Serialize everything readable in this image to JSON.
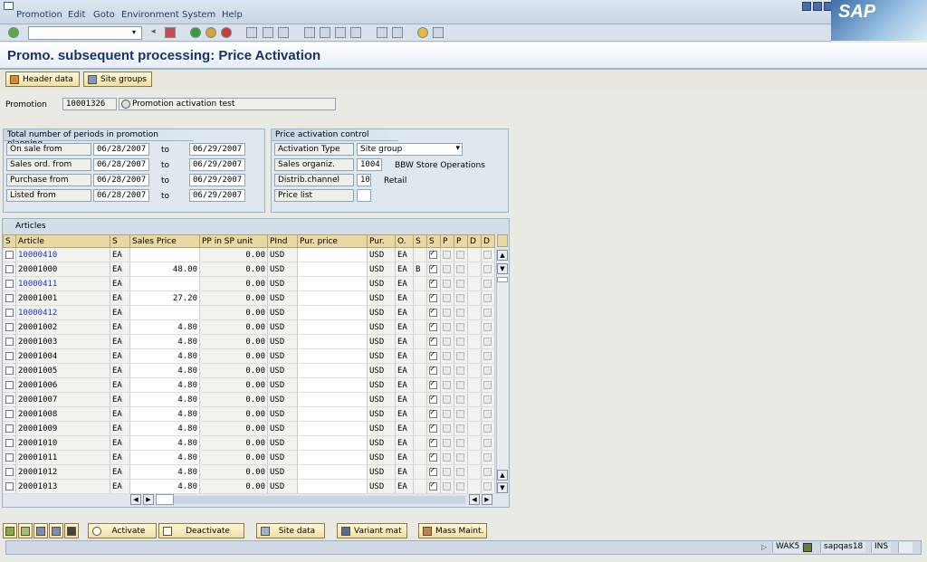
{
  "menu": {
    "items": [
      "Promotion",
      "Edit",
      "Goto",
      "Environment",
      "System",
      "Help"
    ]
  },
  "logo": "SAP",
  "toolbar": {
    "command_value": ""
  },
  "page_title": "Promo. subsequent processing: Price Activation",
  "app_buttons": {
    "header_data": "Header data",
    "site_groups": "Site groups"
  },
  "promotion": {
    "label": "Promotion",
    "number": "10001326",
    "description": "Promotion activation test"
  },
  "periods": {
    "title": "Total number of periods in promotion planning",
    "to_label": "to",
    "rows": [
      {
        "label": "On sale from",
        "from": "06/28/2007",
        "to": "06/29/2007"
      },
      {
        "label": "Sales ord. from",
        "from": "06/28/2007",
        "to": "06/29/2007"
      },
      {
        "label": "Purchase from",
        "from": "06/28/2007",
        "to": "06/29/2007"
      },
      {
        "label": "Listed from",
        "from": "06/28/2007",
        "to": "06/29/2007"
      }
    ]
  },
  "price_control": {
    "title": "Price activation control",
    "activation_type_label": "Activation Type",
    "activation_type_value": "Site group",
    "sales_org_label": "Sales organiz.",
    "sales_org_value": "1004",
    "sales_org_text": "BBW Store Operations",
    "distrib_label": "Distrib.channel",
    "distrib_value": "10",
    "distrib_text": "Retail",
    "price_list_label": "Price list",
    "price_list_value": ""
  },
  "articles": {
    "title": "Articles",
    "columns": [
      "S",
      "Article",
      "S",
      "Sales Price",
      "PP in SP unit",
      "PInd",
      "Pur. price",
      "Pur.",
      "O.",
      "S",
      "S",
      "P",
      "P",
      "D",
      "D"
    ],
    "rows": [
      {
        "article": "10000410",
        "link": true,
        "unit": "EA",
        "sales_price": "",
        "pp": "0.00",
        "pind": "USD",
        "pur_price": "",
        "pur": "USD",
        "o": "EA",
        "s": ""
      },
      {
        "article": "20001000",
        "link": false,
        "unit": "EA",
        "sales_price": "48.00",
        "pp": "0.00",
        "pind": "USD",
        "pur_price": "",
        "pur": "USD",
        "o": "EA",
        "s": "B"
      },
      {
        "article": "10000411",
        "link": true,
        "unit": "EA",
        "sales_price": "",
        "pp": "0.00",
        "pind": "USD",
        "pur_price": "",
        "pur": "USD",
        "o": "EA",
        "s": ""
      },
      {
        "article": "20001001",
        "link": false,
        "unit": "EA",
        "sales_price": "27.20",
        "pp": "0.00",
        "pind": "USD",
        "pur_price": "",
        "pur": "USD",
        "o": "EA",
        "s": ""
      },
      {
        "article": "10000412",
        "link": true,
        "unit": "EA",
        "sales_price": "",
        "pp": "0.00",
        "pind": "USD",
        "pur_price": "",
        "pur": "USD",
        "o": "EA",
        "s": ""
      },
      {
        "article": "20001002",
        "link": false,
        "unit": "EA",
        "sales_price": "4.80",
        "pp": "0.00",
        "pind": "USD",
        "pur_price": "",
        "pur": "USD",
        "o": "EA",
        "s": ""
      },
      {
        "article": "20001003",
        "link": false,
        "unit": "EA",
        "sales_price": "4.80",
        "pp": "0.00",
        "pind": "USD",
        "pur_price": "",
        "pur": "USD",
        "o": "EA",
        "s": ""
      },
      {
        "article": "20001004",
        "link": false,
        "unit": "EA",
        "sales_price": "4.80",
        "pp": "0.00",
        "pind": "USD",
        "pur_price": "",
        "pur": "USD",
        "o": "EA",
        "s": ""
      },
      {
        "article": "20001005",
        "link": false,
        "unit": "EA",
        "sales_price": "4.80",
        "pp": "0.00",
        "pind": "USD",
        "pur_price": "",
        "pur": "USD",
        "o": "EA",
        "s": ""
      },
      {
        "article": "20001006",
        "link": false,
        "unit": "EA",
        "sales_price": "4.80",
        "pp": "0.00",
        "pind": "USD",
        "pur_price": "",
        "pur": "USD",
        "o": "EA",
        "s": ""
      },
      {
        "article": "20001007",
        "link": false,
        "unit": "EA",
        "sales_price": "4.80",
        "pp": "0.00",
        "pind": "USD",
        "pur_price": "",
        "pur": "USD",
        "o": "EA",
        "s": ""
      },
      {
        "article": "20001008",
        "link": false,
        "unit": "EA",
        "sales_price": "4.80",
        "pp": "0.00",
        "pind": "USD",
        "pur_price": "",
        "pur": "USD",
        "o": "EA",
        "s": ""
      },
      {
        "article": "20001009",
        "link": false,
        "unit": "EA",
        "sales_price": "4.80",
        "pp": "0.00",
        "pind": "USD",
        "pur_price": "",
        "pur": "USD",
        "o": "EA",
        "s": ""
      },
      {
        "article": "20001010",
        "link": false,
        "unit": "EA",
        "sales_price": "4.80",
        "pp": "0.00",
        "pind": "USD",
        "pur_price": "",
        "pur": "USD",
        "o": "EA",
        "s": ""
      },
      {
        "article": "20001011",
        "link": false,
        "unit": "EA",
        "sales_price": "4.80",
        "pp": "0.00",
        "pind": "USD",
        "pur_price": "",
        "pur": "USD",
        "o": "EA",
        "s": ""
      },
      {
        "article": "20001012",
        "link": false,
        "unit": "EA",
        "sales_price": "4.80",
        "pp": "0.00",
        "pind": "USD",
        "pur_price": "",
        "pur": "USD",
        "o": "EA",
        "s": ""
      },
      {
        "article": "20001013",
        "link": false,
        "unit": "EA",
        "sales_price": "4.80",
        "pp": "0.00",
        "pind": "USD",
        "pur_price": "",
        "pur": "USD",
        "o": "EA",
        "s": ""
      }
    ]
  },
  "bottom_buttons": {
    "activate": "Activate",
    "deactivate": "Deactivate",
    "site_data": "Site data",
    "variant_mat": "Variant mat",
    "mass_maint": "Mass Maint."
  },
  "status": {
    "transaction": "WAK5",
    "server": "sapqas18",
    "mode": "INS"
  },
  "colors": {
    "title": "#16346a",
    "link": "#1d34c4",
    "table_header": "#e9d8a4"
  }
}
